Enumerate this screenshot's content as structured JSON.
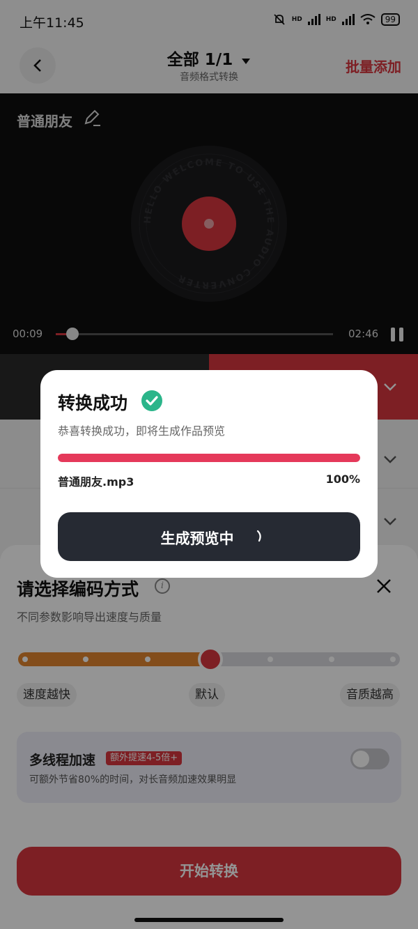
{
  "status_bar": {
    "time": "上午11:45",
    "battery": "99",
    "net1": "HD",
    "net2": "HD"
  },
  "header": {
    "title": "全部 1/1",
    "subtitle": "音频格式转换",
    "batch_add": "批量添加"
  },
  "player": {
    "track_name": "普通朋友",
    "disc_text": "HELLO WELCOME TO USE THE AUDIO CONVERTER",
    "current_time": "00:09",
    "total_time": "02:46",
    "progress": 0.06
  },
  "encoding_sheet": {
    "title": "请选择编码方式",
    "subtitle": "不同参数影响导出速度与质量",
    "options": [
      "速度越快",
      "默认",
      "音质越高"
    ],
    "selected_option": "默认",
    "multithread": {
      "title": "多线程加速",
      "badge": "额外提速4-5倍+",
      "description": "可额外节省80%的时间，对长音频加速效果明显",
      "enabled": false
    },
    "start_button": "开始转换"
  },
  "success_dialog": {
    "title": "转换成功",
    "subtitle": "恭喜转换成功，即将生成作品预览",
    "file_name": "普通朋友.mp3",
    "percent_label": "100%",
    "progress": 1.0,
    "button_label": "生成预览中"
  },
  "colors": {
    "accent": "#d8363f",
    "success": "#2bb58a",
    "progress": "#e5395a",
    "slider_left": "#e2862f"
  }
}
